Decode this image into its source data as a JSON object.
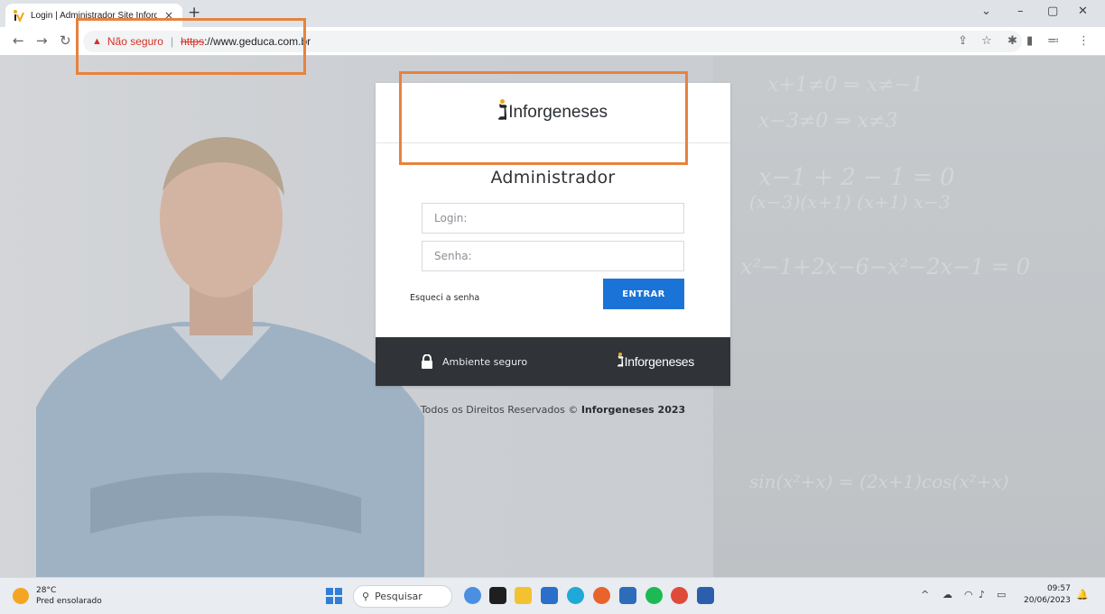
{
  "browser": {
    "tab_title": "Login | Administrador Site Inforg",
    "tab_close": "×",
    "new_tab": "+",
    "warning_icon": "▲",
    "not_secure_label": "Não seguro",
    "separator": "|",
    "url_scheme": "https",
    "url_rest": "://www.geduca.com.br"
  },
  "login": {
    "logo_text": "Inforgeneses",
    "title": "Administrador",
    "login_placeholder": "Login:",
    "password_placeholder": "Senha:",
    "forgot_password": "Esqueci a senha",
    "submit_label": "ENTRAR",
    "secure_label": "Ambiente seguro",
    "footer_logo_text": "Inforgeneses"
  },
  "copyright": {
    "prefix": "Todos os Direitos Reservados ©",
    "company": "Inforgeneses 2023"
  },
  "taskbar": {
    "temperature": "28°C",
    "weather_desc": "Pred ensolarado",
    "search_label": "Pesquisar",
    "time": "09:57",
    "date": "20/06/2023"
  },
  "colors": {
    "accent": "#1a73d6",
    "highlight": "#e8823d",
    "footer_bg": "#303438",
    "logo_dot": "#f2a516"
  }
}
